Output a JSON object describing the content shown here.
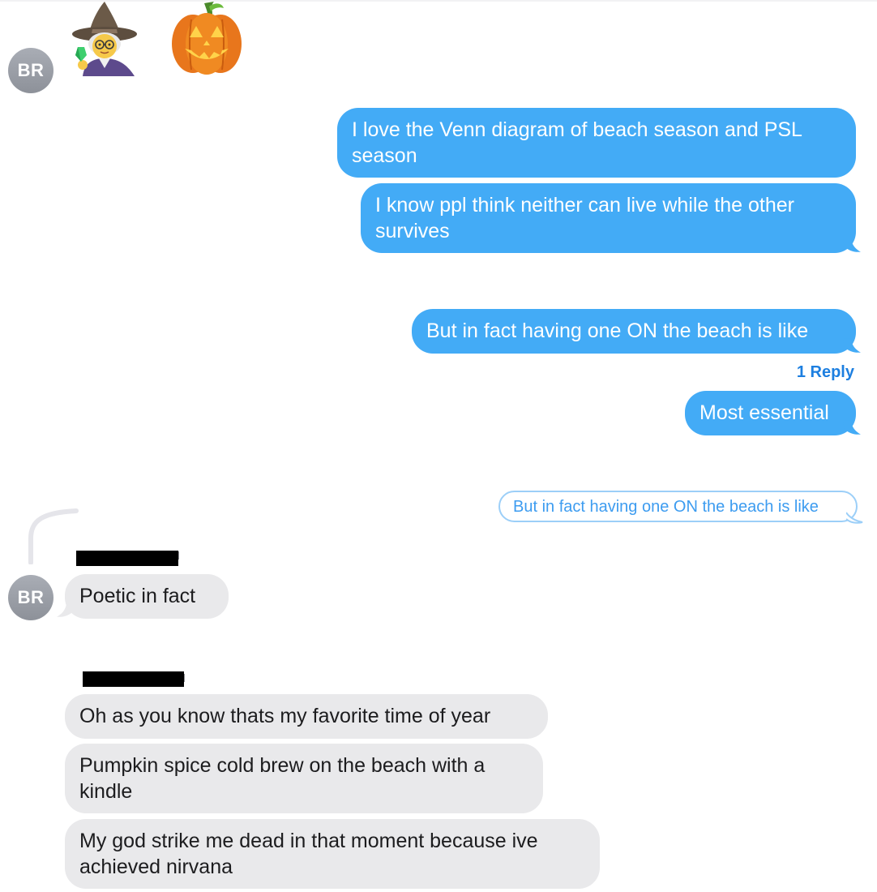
{
  "conversation": {
    "avatar_initials": "BR",
    "top_emoji": {
      "first": "mage-emoji",
      "second": "jack-o-lantern-emoji"
    },
    "outgoing": [
      {
        "text": "I love the Venn diagram of beach season and PSL season"
      },
      {
        "text": "I know ppl think neither can live while the other survives"
      },
      {
        "text": "But in fact having one ON the beach is like"
      },
      {
        "text": "Most essential"
      }
    ],
    "reply_count_label": "1 Reply",
    "quoted_reply": "But in fact having one ON the beach is like",
    "incoming_reply": "Poetic in fact",
    "incoming": [
      {
        "text": "Oh as you know thats my favorite time of year"
      },
      {
        "text": "Pumpkin spice cold brew on the beach with a kindle"
      },
      {
        "text": "My god strike me dead in that moment because ive achieved nirvana"
      }
    ],
    "colors": {
      "outgoing_bubble": "#43abf6",
      "incoming_bubble": "#e9e9eb",
      "reply_link": "#1d7fe0",
      "avatar": "#9a9ea6"
    }
  }
}
